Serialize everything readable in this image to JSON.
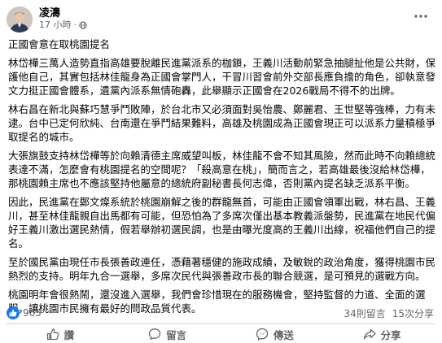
{
  "post": {
    "author": "凌濤",
    "time": "17 小時",
    "paragraphs": [
      "正國會意在取桃園提名",
      "林岱樺三萬人造勢直指高雄要脫離民進黨派系的枷鎖，王義川活動前緊急抽腿扯他是公共財，保護他自己，其實包括林佳龍身為正國會掌門人，干冒川習會前外交部長應負擔的角色，卻執意發文力挺正國會體系，遺黨內派系無情砲轟，此舉顯示正國會在2026戰局不得不的出牌。",
      "林右昌在新北與蘇巧慧爭鬥敗陣，於台北市又必須面對吳怡農、鄭麗君、王世堅等強棒，力有未逮。台中已定何欣純、台南還在爭鬥結果難料，高雄及桃園成為正國會現正可以派系力量積極爭取提名的城市。",
      "大張旗鼓支持林岱樺等於向賴清德主席威望叫板，林佳龍不會不知其風險，然而此時不向賴總統表達不滿，怎麼會有桃園提名的空間呢？「殺高意在桃」，簡而言之，若高雄最後沒給林岱樺，那桃園賴主席也不應該堅持他屬意的總統府副秘書長何志偉，否則黨內提名缺乏派系平衡。",
      "因此，民進黨在鄭文燦系統於桃園崩解之後的群龍無首，可能由正國會領軍出戰，林右昌、王義川，甚至林佳龍親自出馬都有可能，但恐怕為了多席次僅出基本教義派盤勢，民進黨在地民代偏好王義川激出選民熱情，假若舉辦初選民調，也是由曝光度高的王義川出線，祝福他們自己的提名。",
      "至於國民黨由現任市長張善政連任，憑藉著穩健的施政成績，及敏銳的政治角度，獲得桃園市民熱烈的支持。明年九合一選舉，多席次民代與張善政市長的聯合競選，是可預見的選戰方向。",
      "桃園明年會很熱鬧，還沒進入選舉，我們會珍惜現在的服務機會，堅持監督的力道、全面的選服，讓桃園市民擁有最好的問政品質代表。"
    ]
  },
  "stats": {
    "reactions": "965",
    "comments": "34則留言",
    "shares": "15次分享"
  },
  "actions": {
    "like": "讚",
    "comment": "留言",
    "send": "傳送",
    "share": "分享"
  },
  "colors": {
    "accent": "#1877f2",
    "secondary_text": "#65676b"
  }
}
